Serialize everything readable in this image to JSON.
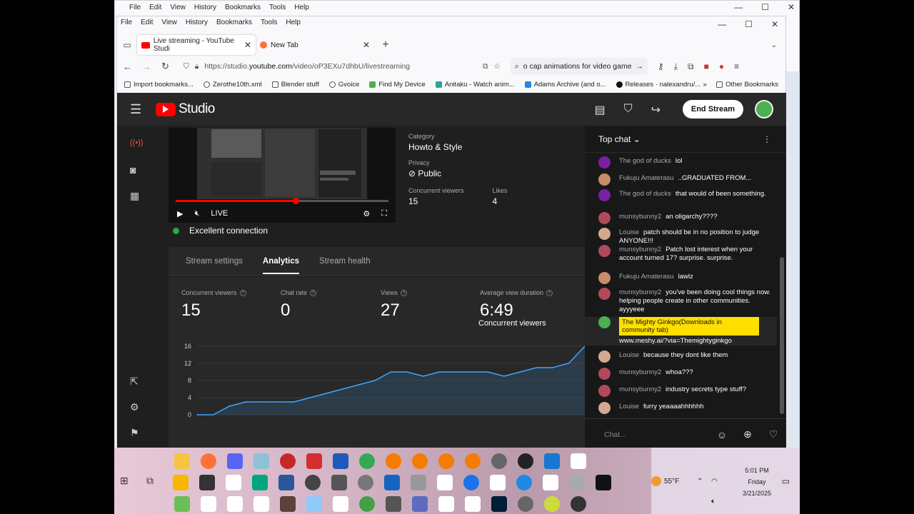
{
  "outer_window": {
    "menu": [
      "File",
      "Edit",
      "View",
      "History",
      "Bookmarks",
      "Tools",
      "Help"
    ]
  },
  "inner_window": {
    "menu": [
      "File",
      "Edit",
      "View",
      "History",
      "Bookmarks",
      "Tools",
      "Help"
    ],
    "tabs": [
      {
        "label": "Live streaming - YouTube Studi",
        "active": true
      },
      {
        "label": "New Tab",
        "active": false
      }
    ],
    "url_prefix": "https://studio.",
    "url_domain": "youtube.com",
    "url_path": "/video/oP3EXu7dhbU/livestreaming",
    "search_value": "o cap animations for video game",
    "bookmarks": [
      "Import bookmarks...",
      "Zerothe10th.xml",
      "Blender stuff",
      "Gvoice",
      "Find My Device",
      "Anitaku - Watch anim...",
      "Adams Archive (and o...",
      "Releases · nalexandru/..."
    ],
    "other_bookmarks": "Other Bookmarks"
  },
  "studio": {
    "logo_text": "Studio",
    "end_stream": "End Stream",
    "category_label": "Category",
    "category_value": "Howto & Style",
    "privacy_label": "Privacy",
    "privacy_value": "Public",
    "concurrent_label": "Concurrent viewers",
    "concurrent_value": "15",
    "likes_label": "Likes",
    "likes_value": "4",
    "live_label": "LIVE",
    "connection": "Excellent connection",
    "tabs": [
      "Stream settings",
      "Analytics",
      "Stream health"
    ],
    "stats": [
      {
        "label": "Concurrent viewers",
        "value": "15"
      },
      {
        "label": "Chat rate",
        "value": "0"
      },
      {
        "label": "Views",
        "value": "27"
      },
      {
        "label": "Average view duration",
        "value": "6:49"
      }
    ],
    "chart_title": "Concurrent viewers"
  },
  "chart_data": {
    "type": "area",
    "title": "Concurrent viewers",
    "yticks": [
      0,
      4,
      8,
      12,
      16
    ],
    "ylim": [
      0,
      16
    ],
    "values": [
      0,
      0,
      2,
      3,
      3,
      3,
      3,
      4,
      5,
      6,
      7,
      8,
      10,
      10,
      9,
      10,
      10,
      10,
      10,
      9,
      10,
      11,
      11,
      12,
      16
    ],
    "color": "#3ea6ff"
  },
  "chat": {
    "header": "Top chat",
    "placeholder": "Chat...",
    "messages": [
      {
        "author": "The god of ducks",
        "text": "lol",
        "color": "#7b1fa2"
      },
      {
        "author": "Fukuju Amaterasu",
        "text": "..GRADUATED FROM...",
        "color": "#c98b6b"
      },
      {
        "author": "The god of ducks",
        "text": "that would of been something.",
        "color": "#7b1fa2"
      },
      {
        "author": "munsybunny2",
        "text": "an oligarchy????",
        "color": "#b04a5a"
      },
      {
        "author": "Louise",
        "text": "patch should be in no position to judge ANYONE!!!",
        "color": "#d4a890"
      },
      {
        "author": "munsybunny2",
        "text": "Patch lost interest when your account turned 17? surprise. surprise.",
        "color": "#b04a5a"
      },
      {
        "author": "Fukuju Amaterasu",
        "text": "lawlz",
        "color": "#c98b6b"
      },
      {
        "author": "munsybunny2",
        "text": "you've been doing cool things now. helping people create in other communities. ayyyeee",
        "color": "#b04a5a"
      },
      {
        "author": "The Mighty Ginkgo(Downloads in community tab)",
        "text": "www.meshy.ai/?via=Themightyginkgo",
        "color": "#4caf50"
      },
      {
        "author": "Louise",
        "text": "because they dont like them",
        "color": "#d4a890"
      },
      {
        "author": "munsybunny2",
        "text": "whoa???",
        "color": "#b04a5a"
      },
      {
        "author": "munsybunny2",
        "text": "industry secrets type stuff?",
        "color": "#b04a5a"
      },
      {
        "author": "Louise",
        "text": "furry yeaaaahhhhhh",
        "color": "#d4a890"
      }
    ]
  },
  "taskbar": {
    "temperature": "55°F",
    "time": "5:01 PM",
    "day": "Friday",
    "date": "3/21/2025"
  }
}
